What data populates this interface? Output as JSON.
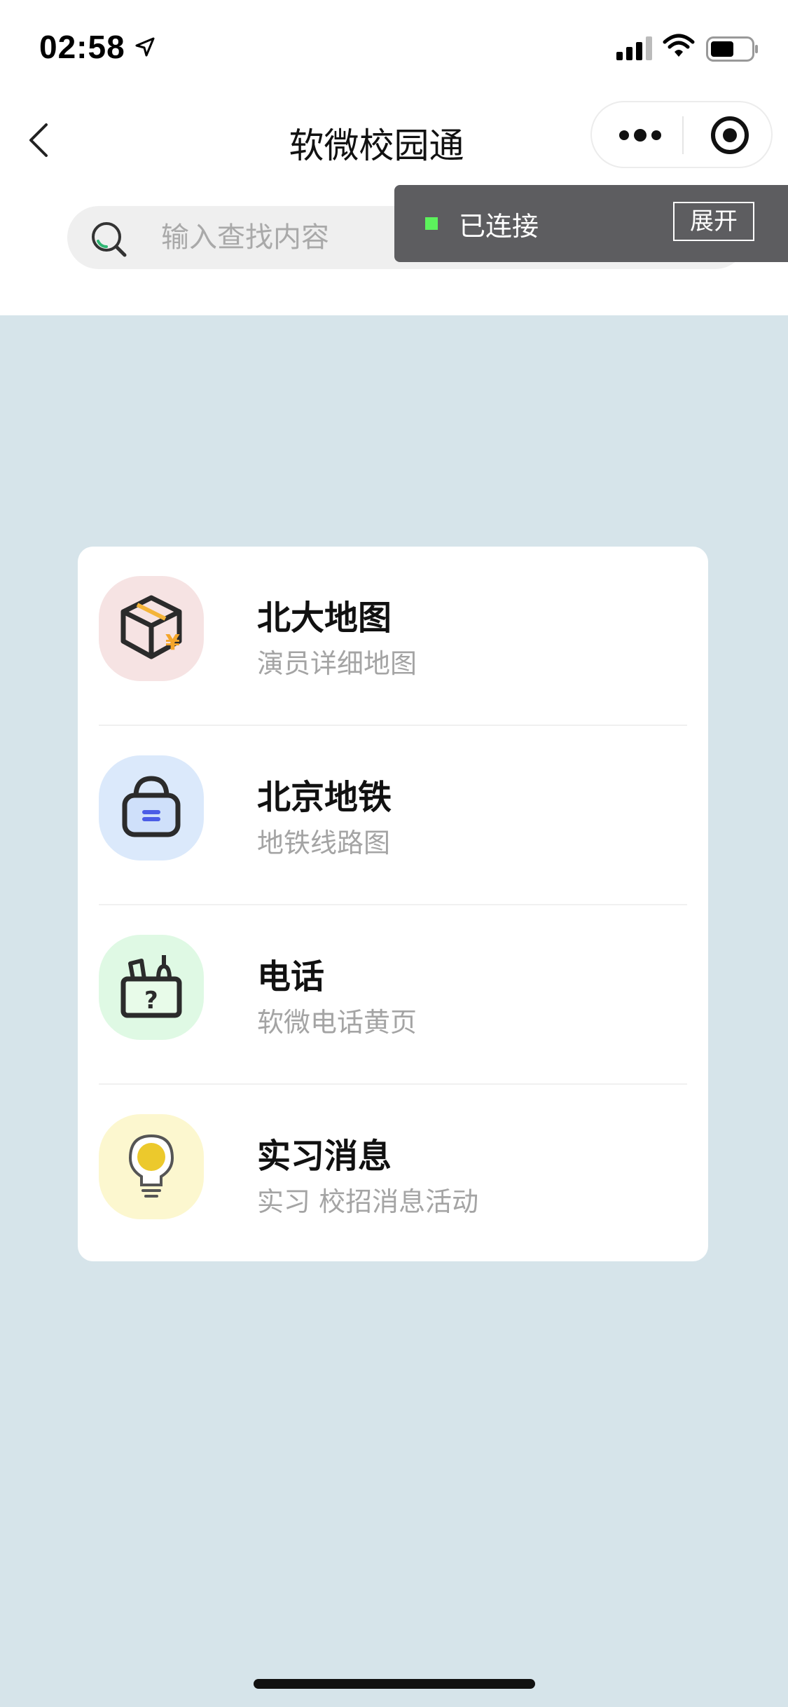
{
  "status_bar": {
    "time": "02:58"
  },
  "nav": {
    "title": "软微校园通"
  },
  "search": {
    "placeholder": "输入查找内容"
  },
  "toast": {
    "status": "已连接",
    "expand_label": "展开"
  },
  "menu": {
    "items": [
      {
        "title": "北大地图",
        "subtitle": "演员详细地图",
        "icon": "box-yuan-icon",
        "icon_bg": "#f6e3e3"
      },
      {
        "title": "北京地铁",
        "subtitle": "地铁线路图",
        "icon": "basket-icon",
        "icon_bg": "#dbe9fb"
      },
      {
        "title": "电话",
        "subtitle": "软微电话黄页",
        "icon": "question-box-icon",
        "icon_bg": "#dff9e4"
      },
      {
        "title": "实习消息",
        "subtitle": "实习 校招消息活动",
        "icon": "lightbulb-icon",
        "icon_bg": "#fcf7cf"
      }
    ]
  },
  "colors": {
    "page_bg": "#d6e4ea",
    "toast_bg": "#5d5d60",
    "connected_dot": "#5cf25c"
  }
}
